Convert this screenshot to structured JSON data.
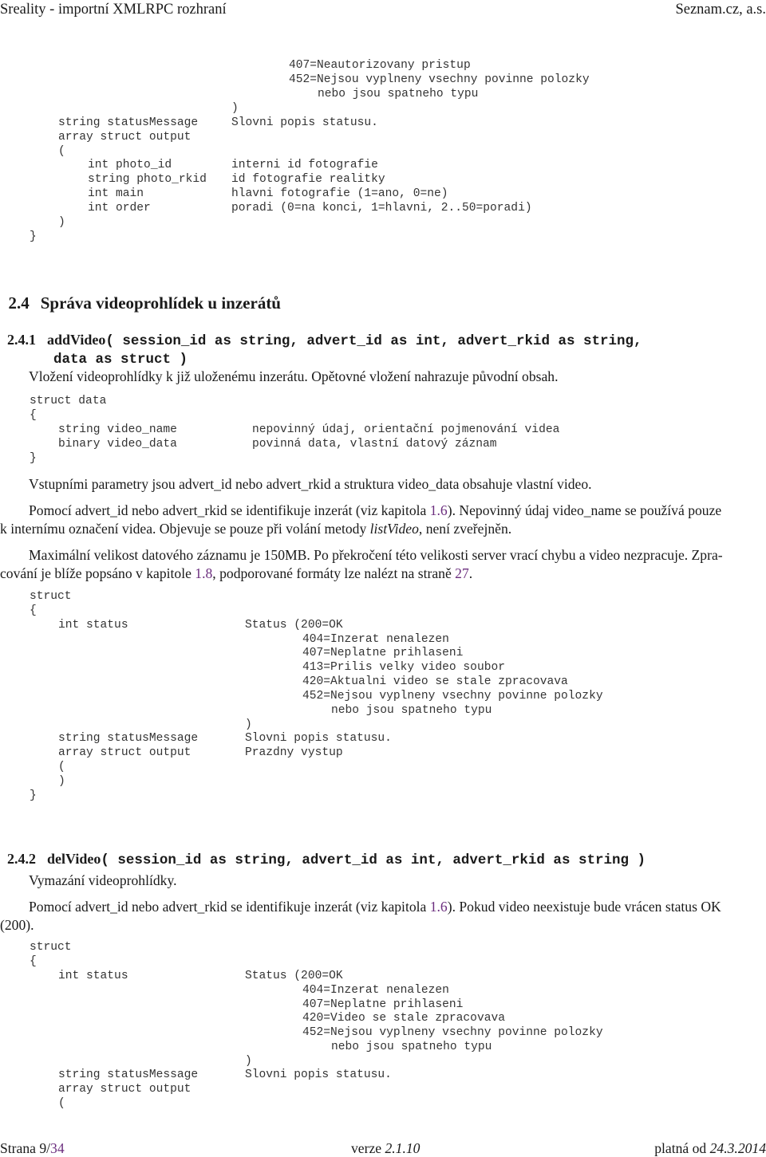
{
  "header": {
    "title": "Sreality - importní XMLRPC rozhraní",
    "company": "Seznam.cz, a.s."
  },
  "top_block": {
    "lines": [
      {
        "left": "",
        "right": "407=Neautorizovany pristup",
        "indent": "status"
      },
      {
        "left": "",
        "right": "452=Nejsou vyplneny vsechny povinne polozky",
        "indent": "status"
      },
      {
        "left": "",
        "right": "nebo jsou spatneho typu",
        "indent": "status2"
      },
      {
        "left": "",
        "right": ")",
        "indent": "desc"
      },
      {
        "left": "string statusMessage",
        "right": "Slovni popis statusu.",
        "indent": "field"
      },
      {
        "left": "array struct output",
        "right": "",
        "indent": "field"
      },
      {
        "left": "(",
        "right": "",
        "indent": "field"
      },
      {
        "left": "int photo_id",
        "right": "interni id fotografie",
        "indent": "nested"
      },
      {
        "left": "string photo_rkid",
        "right": "id fotografie realitky",
        "indent": "nested"
      },
      {
        "left": "int main",
        "right": "hlavni fotografie (1=ano, 0=ne)",
        "indent": "nested"
      },
      {
        "left": "int order",
        "right": "poradi (0=na konci, 1=hlavni, 2..50=poradi)",
        "indent": "nested"
      },
      {
        "left": ")",
        "right": "",
        "indent": "field"
      },
      {
        "left": "}",
        "right": "",
        "indent": "root"
      }
    ]
  },
  "section": {
    "number": "2.4",
    "title": "Správa videoprohlídek u inzerátů"
  },
  "add_video": {
    "number": "2.4.1",
    "name": "addVideo",
    "signature_line1": "( session_id as string, advert_id as int, advert_rkid as string,",
    "signature_line2": "data as struct )",
    "description": "Vložení videoprohlídky k již uloženému inzerátu. Opětovné vložení nahrazuje původní obsah.",
    "struct_data": {
      "header": "struct data",
      "open": "{",
      "fields": [
        {
          "name": "string video_name",
          "desc": "nepovinný údaj, orientační pojmenování videa"
        },
        {
          "name": "binary video_data",
          "desc": "povinná data, vlastní datový záznam"
        }
      ],
      "close": "}"
    },
    "para1": "Vstupními parametry jsou advert_id nebo advert_rkid a struktura video_data obsahuje vlastní video.",
    "para2": {
      "before": "Pomocí advert_id nebo advert_rkid se identifikuje inzerát (viz kapitola ",
      "link": "1.6",
      "after1": "). Nepovinný údaj video_name se používá pouze",
      "line2_before": "k internímu označení videa. Objevuje se pouze při volání metody ",
      "italic": "listVideo",
      "line2_after": ", není zveřejněn."
    },
    "para3": {
      "line1": "Maximální velikost datového záznamu je 150MB. Po překročení této velikosti server vrací chybu a video nezpracuje. Zpra-",
      "line2_before": "cování je blíže popsáno v kapitole ",
      "link1": "1.8",
      "line2_mid": ", podporované formáty lze nalézt na straně ",
      "link2": "27",
      "line2_after": "."
    },
    "return_struct": {
      "header": "struct",
      "open": "{",
      "status_name": "int status",
      "status_first": "Status (200=OK",
      "status_codes": [
        "404=Inzerat nenalezen",
        "407=Neplatne prihlaseni",
        "413=Prilis velky video soubor",
        "420=Aktualni video se stale zpracovava",
        "452=Nejsou vyplneny vsechny povinne polozky"
      ],
      "status_cont": "nebo jsou spatneho typu",
      "status_close": ")",
      "message_name": "string statusMessage",
      "message_desc": "Slovni popis statusu.",
      "output_name": "array struct output",
      "output_desc": "Prazdny vystup",
      "output_open": "(",
      "output_close": ")",
      "close": "}"
    }
  },
  "del_video": {
    "number": "2.4.2",
    "name": "delVideo",
    "signature": "( session_id as string, advert_id as int, advert_rkid as string )",
    "description": "Vymazání videoprohlídky.",
    "para": {
      "before": "Pomocí advert_id nebo advert_rkid se identifikuje inzerát (viz kapitola ",
      "link": "1.6",
      "after": "). Pokud video neexistuje bude vrácen status OK",
      "line2": "(200)."
    },
    "return_struct": {
      "header": "struct",
      "open": "{",
      "status_name": "int status",
      "status_first": "Status (200=OK",
      "status_codes": [
        "404=Inzerat nenalezen",
        "407=Neplatne prihlaseni",
        "420=Video se stale zpracovava",
        "452=Nejsou vyplneny vsechny povinne polozky"
      ],
      "status_cont": "nebo jsou spatneho typu",
      "status_close": ")",
      "message_name": "string statusMessage",
      "message_desc": "Slovni popis statusu.",
      "output_name": "array struct output",
      "output_open": "("
    }
  },
  "footer": {
    "page_label": "Strana 9/",
    "page_total": "34",
    "version_label": "verze ",
    "version": "2.1.10",
    "valid_label": "platná od ",
    "valid_date": "24.3.2014"
  },
  "colors": {
    "link": "#6b2e7e",
    "text": "#1a1a1a",
    "code": "#333333"
  }
}
